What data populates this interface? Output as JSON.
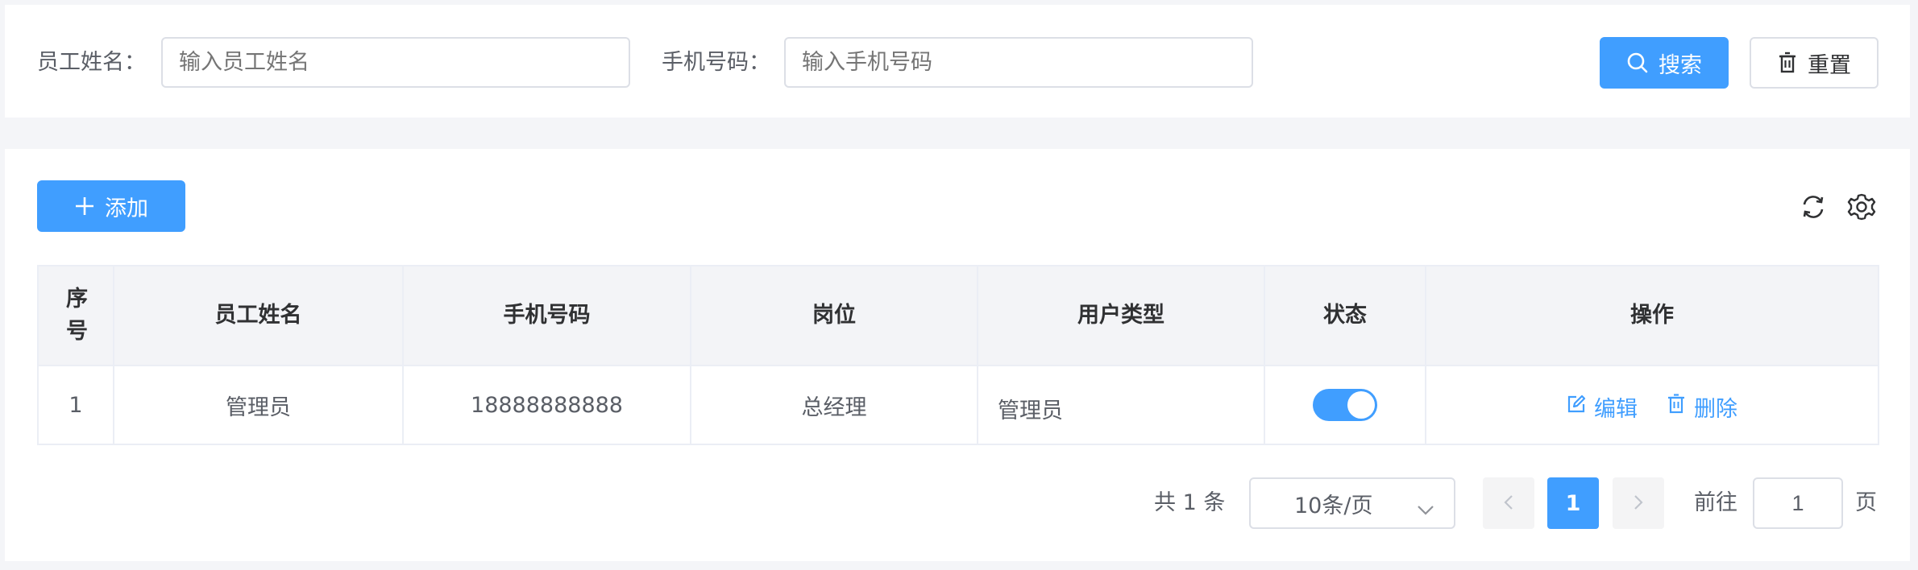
{
  "search": {
    "name_label": "员工姓名：",
    "name_placeholder": "输入员工姓名",
    "phone_label": "手机号码：",
    "phone_placeholder": "输入手机号码",
    "search_button": "搜索",
    "reset_button": "重置"
  },
  "toolbar": {
    "add_button": "添加",
    "refresh_icon": "refresh-icon",
    "settings_icon": "gear-icon"
  },
  "table": {
    "columns": [
      "序号",
      "员工姓名",
      "手机号码",
      "岗位",
      "用户类型",
      "状态",
      "操作"
    ],
    "rows": [
      {
        "index": "1",
        "name": "管理员",
        "phone": "18888888888",
        "position": "总经理",
        "user_type": "管理员",
        "status_on": true,
        "edit_label": "编辑",
        "delete_label": "删除"
      }
    ]
  },
  "pagination": {
    "total_text": "共 1 条",
    "page_size": "10条/页",
    "current_page": "1",
    "goto_label": "前往",
    "goto_value": "1",
    "page_suffix": "页"
  },
  "colors": {
    "primary": "#409eff",
    "border": "#dcdfe6",
    "header_bg": "#f3f4f7"
  }
}
